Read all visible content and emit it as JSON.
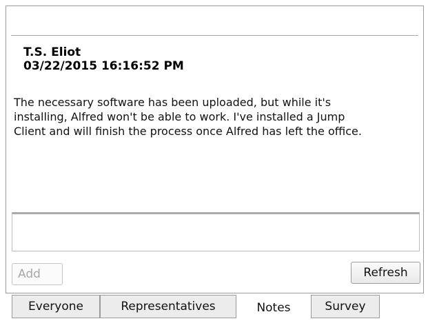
{
  "note": {
    "author": "T.S. Eliot",
    "timestamp": "03/22/2015 16:16:52 PM",
    "body": "The necessary software has been uploaded, but while it's\ninstalling, Alfred won't be able to work. I've installed a Jump\nClient and will finish the process once Alfred has left the office."
  },
  "input": {
    "value": ""
  },
  "buttons": {
    "add": "Add",
    "refresh": "Refresh"
  },
  "tabs": {
    "everyone": "Everyone",
    "representatives": "Representatives",
    "notes": "Notes",
    "survey": "Survey"
  },
  "colors": {
    "border": "#9b9b9b",
    "divider": "#a7a7a7",
    "disabled_text": "#a7a7a7",
    "tab_inactive": "#ececec"
  }
}
